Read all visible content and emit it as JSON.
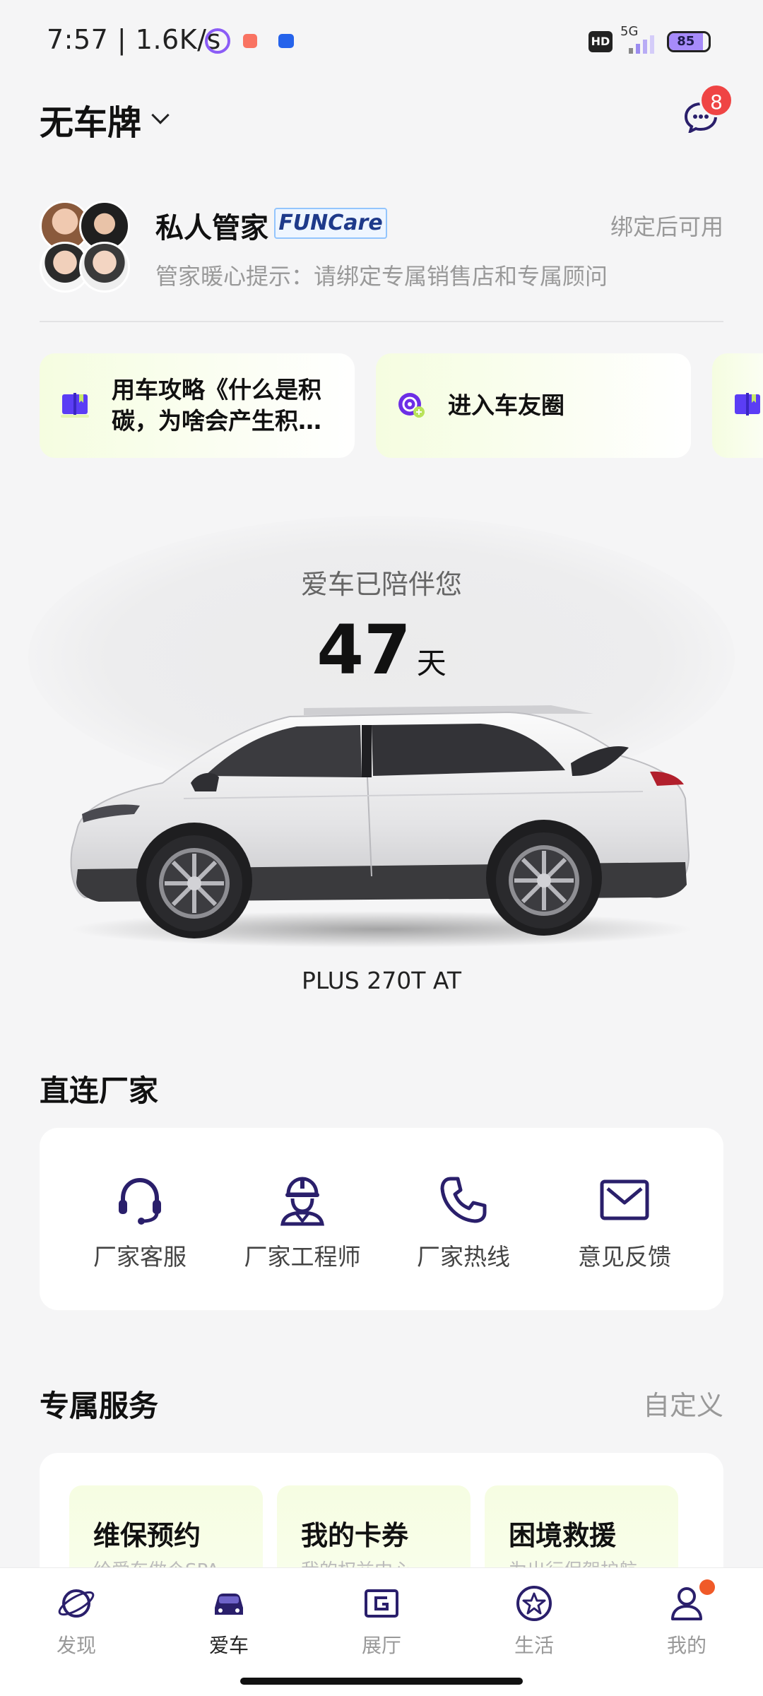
{
  "status_bar": {
    "time": "7:57 | 1.6K/s",
    "hd": "HD",
    "network": "5G",
    "battery": "85"
  },
  "header": {
    "plate": "无车牌",
    "message_count": "8"
  },
  "butler": {
    "title": "私人管家",
    "brand": "FUNCare",
    "status": "绑定后可用",
    "tip": "管家暖心提示：请绑定专属销售店和专属顾问"
  },
  "quick_cards": [
    {
      "text": "用车攻略《什么是积碳，为啥会产生积…",
      "icon": "book-icon"
    },
    {
      "text": "进入车友圈",
      "icon": "community-add-icon"
    }
  ],
  "car": {
    "accompany_text": "爱车已陪伴您",
    "days": "47",
    "days_unit": "天",
    "model": "PLUS 270T AT"
  },
  "direct": {
    "title": "直连厂家",
    "items": [
      {
        "label": "厂家客服",
        "icon": "headset-icon"
      },
      {
        "label": "厂家工程师",
        "icon": "engineer-icon"
      },
      {
        "label": "厂家热线",
        "icon": "phone-icon"
      },
      {
        "label": "意见反馈",
        "icon": "mail-icon"
      }
    ]
  },
  "services": {
    "title": "专属服务",
    "customize": "自定义",
    "tiles": [
      {
        "title": "维保预约",
        "subtitle": "给爱车做个SPA"
      },
      {
        "title": "我的卡券",
        "subtitle": "我的权益中心"
      },
      {
        "title": "困境救援",
        "subtitle": "为出行保驾护航"
      }
    ]
  },
  "bottom_nav": {
    "items": [
      {
        "label": "发现",
        "icon": "planet-icon",
        "active": false
      },
      {
        "label": "爱车",
        "icon": "car-icon",
        "active": true
      },
      {
        "label": "展厅",
        "icon": "showroom-icon",
        "active": false
      },
      {
        "label": "生活",
        "icon": "life-star-icon",
        "active": false
      },
      {
        "label": "我的",
        "icon": "profile-icon",
        "active": false
      }
    ]
  },
  "colors": {
    "accent": "#2a1f6b",
    "badge_red": "#ef4444",
    "card_tint": "#f5fde0"
  }
}
